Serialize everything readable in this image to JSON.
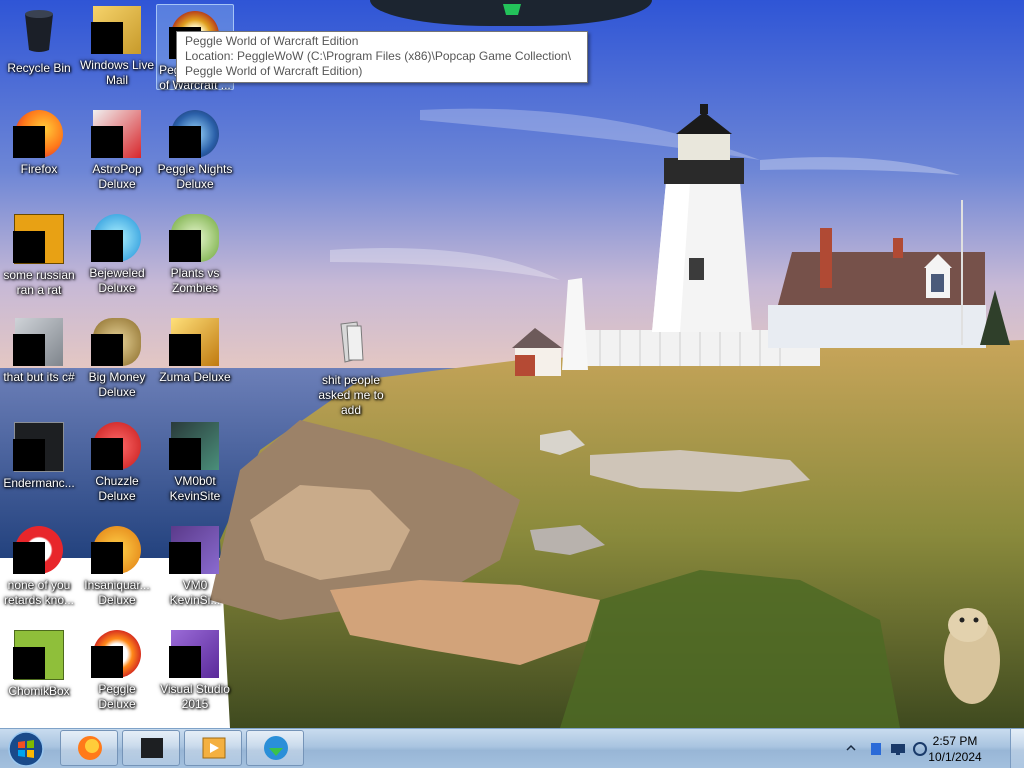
{
  "desktop": {
    "icons": [
      {
        "label": "Recycle Bin"
      },
      {
        "label": "Windows Live Mail"
      },
      {
        "label": "Peggle World of Warcraft ..."
      },
      {
        "label": "Firefox"
      },
      {
        "label": "AstroPop Deluxe"
      },
      {
        "label": "Peggle Nights Deluxe"
      },
      {
        "label": "some russian ran a rat"
      },
      {
        "label": "Bejeweled Deluxe"
      },
      {
        "label": "Plants vs Zombies"
      },
      {
        "label": "that but its c#"
      },
      {
        "label": "Big Money Deluxe"
      },
      {
        "label": "Zuma Deluxe"
      },
      {
        "label": "shit people asked me to add"
      },
      {
        "label": "Endermanc..."
      },
      {
        "label": "Chuzzle Deluxe"
      },
      {
        "label": "VM0b0t KevinSite"
      },
      {
        "label": "none of you retards kno..."
      },
      {
        "label": "Insaniquar... Deluxe"
      },
      {
        "label": "VM0 KevinSi..."
      },
      {
        "label": "ChomikBox"
      },
      {
        "label": "Peggle Deluxe"
      },
      {
        "label": "Visual Studio 2015"
      }
    ]
  },
  "tooltip": {
    "line1": "Peggle World of Warcraft Edition",
    "line2": "Location: PeggleWoW (C:\\Program Files (x86)\\Popcap Game Collection\\",
    "line3": "Peggle World of Warcraft Edition)"
  },
  "taskbar": {
    "time": "2:57 PM",
    "date": "10/1/2024"
  },
  "colors": {
    "sky_top": "#3b5fcf",
    "sea": "#3a5f9e",
    "grass": "#8b8a3a",
    "taskbar": "#a9c4e0"
  }
}
